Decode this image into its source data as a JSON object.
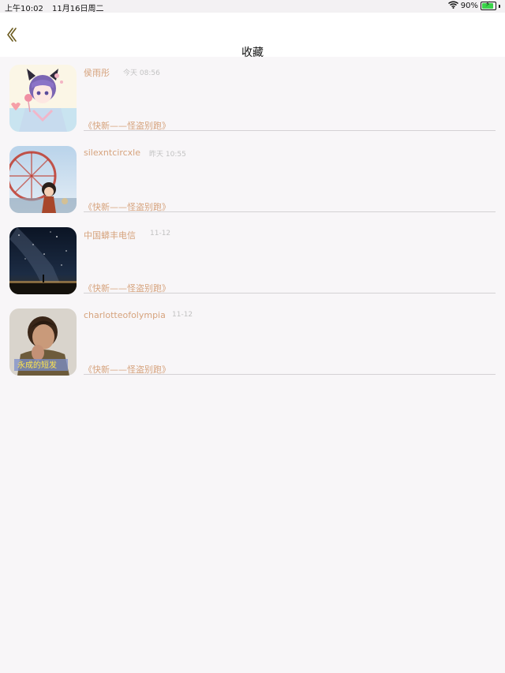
{
  "status_bar": {
    "time": "上午10:02",
    "date": "11月16日周二",
    "battery_percent": "90%",
    "battery_level": 0.9,
    "wifi_icon": "wifi-icon"
  },
  "nav": {
    "back_icon": "chevron-left-icon",
    "title": "收藏"
  },
  "favorites": [
    {
      "user": "侯雨彤",
      "time": "今天 08:56",
      "work": "《快新——怪盗别跑》",
      "avatar": "anime-catboy-avatar"
    },
    {
      "user": "silexntcircxle",
      "time": "昨天 10:55",
      "work": "《快新——怪盗别跑》",
      "avatar": "figurine-ferris-wheel-avatar"
    },
    {
      "user": "中国蟒丰电信",
      "time": "11-12",
      "work": "《快新——怪盗别跑》",
      "avatar": "milky-way-avatar"
    },
    {
      "user": "charlotteofolympia",
      "time": "11-12",
      "work": "《快新——怪盗别跑》",
      "avatar": "portrait-avatar",
      "avatar_caption": "永成的短发"
    }
  ]
}
